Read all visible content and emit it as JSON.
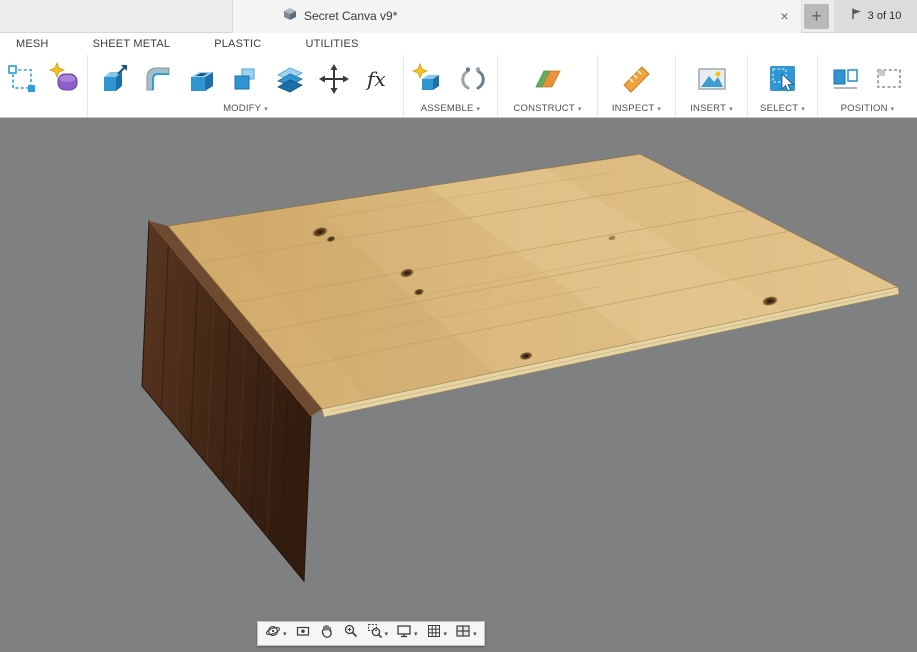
{
  "titlebar": {
    "tab_title": "Secret Canva v9*",
    "close_label": "×",
    "new_tab_label": "+",
    "counter": "3 of 10"
  },
  "ribbon_tabs": [
    {
      "label": "MESH"
    },
    {
      "label": "SHEET METAL"
    },
    {
      "label": "PLASTIC"
    },
    {
      "label": "UTILITIES"
    }
  ],
  "toolbar": {
    "fx_label": "fx",
    "groups": [
      {
        "label": "",
        "icons": [
          "create-sketch-icon",
          "create-form-icon"
        ]
      },
      {
        "label": "MODIFY",
        "icons": [
          "press-pull-icon",
          "fillet-icon",
          "shell-icon",
          "combine-icon",
          "offset-face-icon",
          "move-copy-icon",
          "parameters-fx-icon"
        ]
      },
      {
        "label": "ASSEMBLE",
        "icons": [
          "new-component-icon",
          "joint-icon"
        ]
      },
      {
        "label": "CONSTRUCT",
        "icons": [
          "construct-plane-icon"
        ]
      },
      {
        "label": "INSPECT",
        "icons": [
          "measure-icon"
        ]
      },
      {
        "label": "INSERT",
        "icons": [
          "canvas-icon"
        ]
      },
      {
        "label": "SELECT",
        "icons": [
          "select-icon"
        ]
      },
      {
        "label": "POSITION",
        "icons": [
          "capture-position-icon",
          "revert-position-icon"
        ]
      }
    ]
  },
  "viewport": {
    "content": "3D model: light plywood tabletop panel joined at its left edge to a dark walnut plank hanging downward",
    "background_color": "#7e8081",
    "plywood_color": "#d9b77e",
    "plank_color": "#46291a",
    "accent_blue": "#2f96d3"
  },
  "navbar": {
    "icons": [
      "orbit-icon",
      "look-at-icon",
      "pan-icon",
      "zoom-icon",
      "zoom-window-icon",
      "display-settings-icon",
      "grid-display-icon",
      "multiple-views-icon"
    ]
  }
}
